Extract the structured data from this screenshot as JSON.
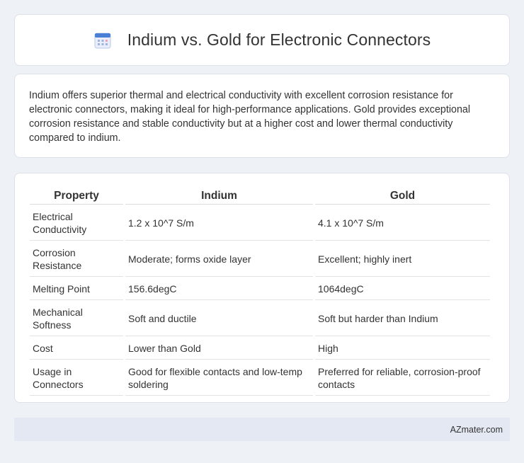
{
  "header": {
    "title": "Indium vs. Gold for Electronic Connectors",
    "icon": "calendar-icon"
  },
  "summary": {
    "text": "Indium offers superior thermal and electrical conductivity with excellent corrosion resistance for electronic connectors, making it ideal for high-performance applications. Gold provides exceptional corrosion resistance and stable conductivity but at a higher cost and lower thermal conductivity compared to indium."
  },
  "table": {
    "headers": [
      "Property",
      "Indium",
      "Gold"
    ],
    "rows": [
      [
        "Electrical Conductivity",
        "1.2 x 10^7 S/m",
        "4.1 x 10^7 S/m"
      ],
      [
        "Corrosion Resistance",
        "Moderate; forms oxide layer",
        "Excellent; highly inert"
      ],
      [
        "Melting Point",
        "156.6degC",
        "1064degC"
      ],
      [
        "Mechanical Softness",
        "Soft and ductile",
        "Soft but harder than Indium"
      ],
      [
        "Cost",
        "Lower than Gold",
        "High"
      ],
      [
        "Usage in Connectors",
        "Good for flexible contacts and low-temp soldering",
        "Preferred for reliable, corrosion-proof contacts"
      ]
    ]
  },
  "footer": {
    "site": "AZmater.com"
  },
  "colors": {
    "background": "#eef1f6",
    "card": "#ffffff",
    "footer": "#e3e8f3",
    "icon_blue": "#4a7fd6",
    "icon_pink": "#f0a0b8"
  }
}
